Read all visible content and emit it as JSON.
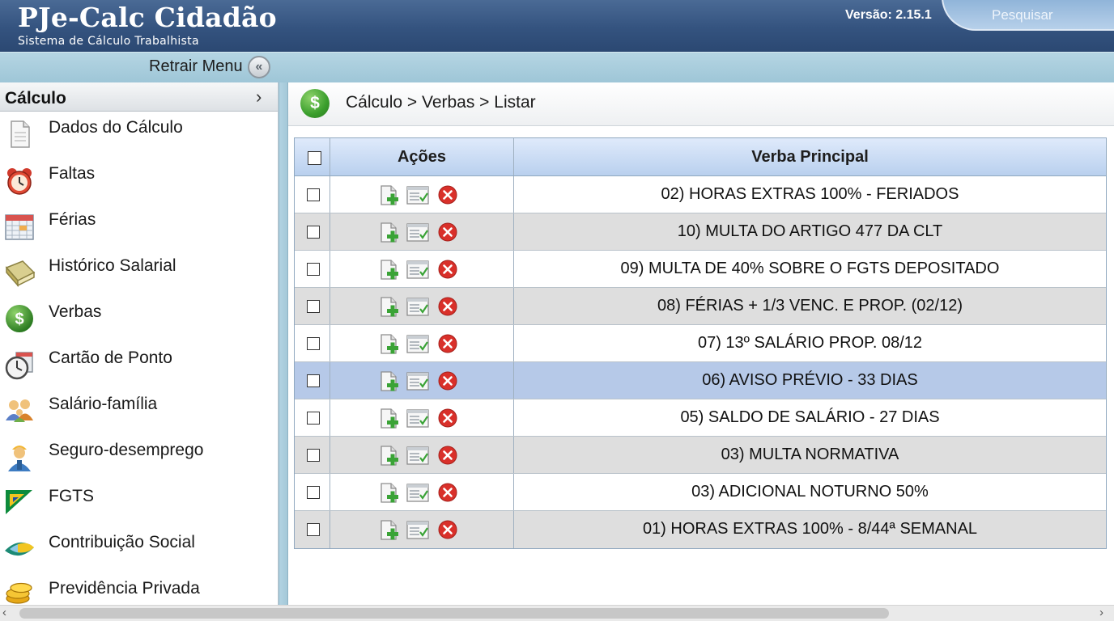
{
  "header": {
    "brand_title": "PJe-Calc Cidadão",
    "brand_subtitle": "Sistema de Cálculo Trabalhista",
    "version": "Versão: 2.15.1",
    "search_label": "Pesquisar"
  },
  "menubar": {
    "retract_label": "Retrair Menu",
    "retract_icon": "double-chevron-left-icon"
  },
  "sidebar": {
    "header_label": "Cálculo",
    "items": [
      {
        "label": "Dados do Cálculo",
        "icon": "document-icon"
      },
      {
        "label": "Faltas",
        "icon": "alarm-clock-icon"
      },
      {
        "label": "Férias",
        "icon": "calendar-icon"
      },
      {
        "label": "Histórico Salarial",
        "icon": "book-icon"
      },
      {
        "label": "Verbas",
        "icon": "dollar-icon"
      },
      {
        "label": "Cartão de Ponto",
        "icon": "stopwatch-icon"
      },
      {
        "label": "Salário-família",
        "icon": "family-icon"
      },
      {
        "label": "Seguro-desemprego",
        "icon": "worker-icon"
      },
      {
        "label": "FGTS",
        "icon": "fgts-logo-icon"
      },
      {
        "label": "Contribuição Social",
        "icon": "contribution-icon"
      },
      {
        "label": "Previdência Privada",
        "icon": "coins-icon"
      }
    ]
  },
  "breadcrumb": {
    "text": "Cálculo > Verbas > Listar",
    "icon": "dollar-icon"
  },
  "table": {
    "col_acoes": "Ações",
    "col_verba": "Verba Principal",
    "action_icons": [
      "add-reflex-icon",
      "edit-parameters-icon",
      "delete-icon"
    ],
    "selected_row": 5,
    "rows": [
      {
        "verba": "02) HORAS EXTRAS 100% - FERIADOS"
      },
      {
        "verba": "10) MULTA DO ARTIGO 477 DA CLT"
      },
      {
        "verba": "09) MULTA DE 40% SOBRE O FGTS DEPOSITADO"
      },
      {
        "verba": "08) FÉRIAS + 1/3 VENC. E PROP. (02/12)"
      },
      {
        "verba": "07) 13º SALÁRIO PROP. 08/12"
      },
      {
        "verba": "06) AVISO PRÉVIO - 33 DIAS"
      },
      {
        "verba": "05) SALDO DE SALÁRIO - 27 DIAS"
      },
      {
        "verba": "03) MULTA NORMATIVA"
      },
      {
        "verba": "03) ADICIONAL NOTURNO 50%"
      },
      {
        "verba": "01) HORAS EXTRAS 100% - 8/44ª SEMANAL"
      }
    ]
  },
  "colors": {
    "header_bg": "#34537f",
    "menubar_bg": "#a8cddd",
    "table_header_bg": "#c6daf2",
    "row_alt_bg": "#dedede",
    "row_selected_bg": "#b6c9e8"
  }
}
